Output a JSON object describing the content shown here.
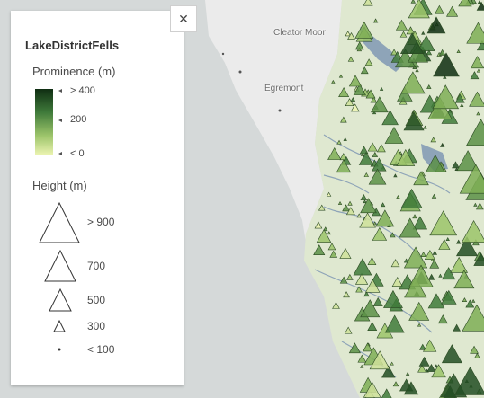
{
  "legend": {
    "title": "LakeDistrictFells",
    "prominence": {
      "title": "Prominence (m)",
      "labels": [
        "> 400",
        "200",
        "< 0"
      ],
      "ramp_colors": [
        "#0f2e12",
        "#3f7a3a",
        "#9cc46a",
        "#eef5b3"
      ]
    },
    "height": {
      "title": "Height (m)",
      "labels": [
        "> 900",
        "700",
        "500",
        "300",
        "< 100"
      ]
    }
  },
  "close_button": {
    "symbol": "✕",
    "icon": "close-icon"
  },
  "map": {
    "place_labels": [
      "Cleator Moor",
      "Egremont"
    ],
    "colors": {
      "sea": "#d5d9d9",
      "land": "#dfe8d0",
      "relief": "#ebebeb",
      "water": "#8ea4b8"
    }
  }
}
